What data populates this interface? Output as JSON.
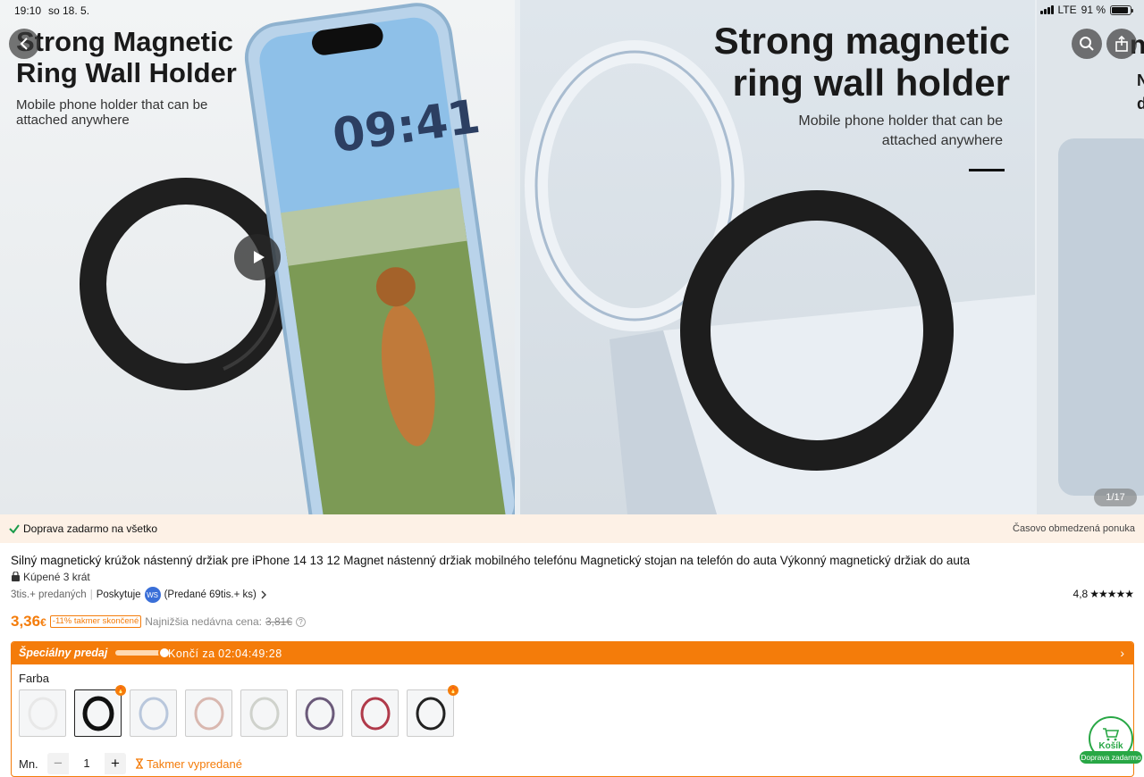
{
  "status_bar": {
    "time": "19:10",
    "date": "so 18. 5.",
    "network": "LTE",
    "battery": "91 %"
  },
  "gallery": {
    "slide1": {
      "title": "Strong Magnetic Ring Wall Holder",
      "subtitle": "Mobile phone holder that can be attached anywhere",
      "phone_time": "09:41"
    },
    "slide2": {
      "title": "Strong magnetic ring wall holder",
      "subtitle": "Mobile phone holder that can be attached anywhere"
    },
    "slide3": {
      "title_fragment": "n",
      "sub_fragment_1": "N",
      "sub_fragment_2": "d"
    },
    "counter": "1/17"
  },
  "banner": {
    "free_shipping": "Doprava zadarmo na všetko",
    "limited": "Časovo obmedzená ponuka"
  },
  "product": {
    "title": "Silný magnetický krúžok nástenný držiak pre iPhone 14 13 12 Magnet nástenný držiak mobilného telefónu Magnetický stojan na telefón do auta Výkonný magnetický držiak do auta",
    "bought": "Kúpené 3 krát",
    "sold": "3tis.+ predaných",
    "provided_by": "Poskytuje",
    "store_badge": "WS",
    "store_sold": "(Predané 69tis.+ ks)",
    "rating": "4,8",
    "price_main": "3,36",
    "currency": "€",
    "discount": "-11% takmer skončené",
    "lowest_label": "Najnižšia nedávna cena:",
    "lowest_price": "3,81€"
  },
  "special": {
    "label": "Špeciálny predaj",
    "ends_label": "Končí za",
    "countdown": "02:04:49:28"
  },
  "options": {
    "color_label": "Farba",
    "swatches": [
      {
        "color": "#e8e8e8",
        "hot": false
      },
      {
        "color": "#111111",
        "hot": true
      },
      {
        "color": "#b9c7dc",
        "hot": false
      },
      {
        "color": "#d9b8b0",
        "hot": false
      },
      {
        "color": "#cfd2cc",
        "hot": false
      },
      {
        "color": "#6b5a7a",
        "hot": false
      },
      {
        "color": "#b03a4a",
        "hot": false
      },
      {
        "color": "#222222",
        "hot": true
      }
    ],
    "qty_label": "Mn.",
    "qty_value": "1",
    "stock_note": "Takmer vypredané"
  },
  "cart": {
    "label": "Košík",
    "badge": "Doprava zadarmo"
  },
  "colors": {
    "accent": "#f47c0a",
    "green": "#28a745"
  }
}
